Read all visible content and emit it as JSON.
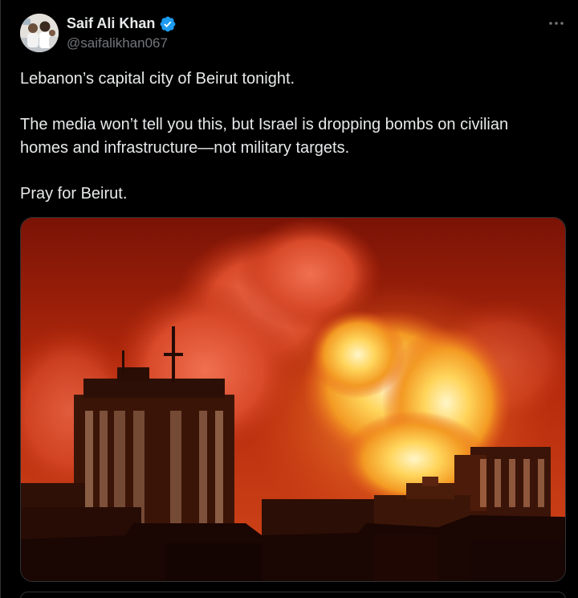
{
  "author": {
    "display_name": "Saif Ali Khan",
    "handle": "@saifalikhan067",
    "verified": true,
    "verified_color": "#1d9bf0"
  },
  "tweet": {
    "lines": [
      "Lebanon’s capital city of Beirut tonight.",
      "The media won’t tell you this, but Israel is dropping bombs on civilian homes and infrastructure—not military targets.",
      "Pray for Beirut."
    ]
  },
  "icons": {
    "more": "more-horizontal-icon",
    "verified": "verified-badge-icon"
  },
  "colors": {
    "background": "#000000",
    "text": "#e7e9ea",
    "secondary": "#71767b",
    "border": "#2f3336"
  }
}
